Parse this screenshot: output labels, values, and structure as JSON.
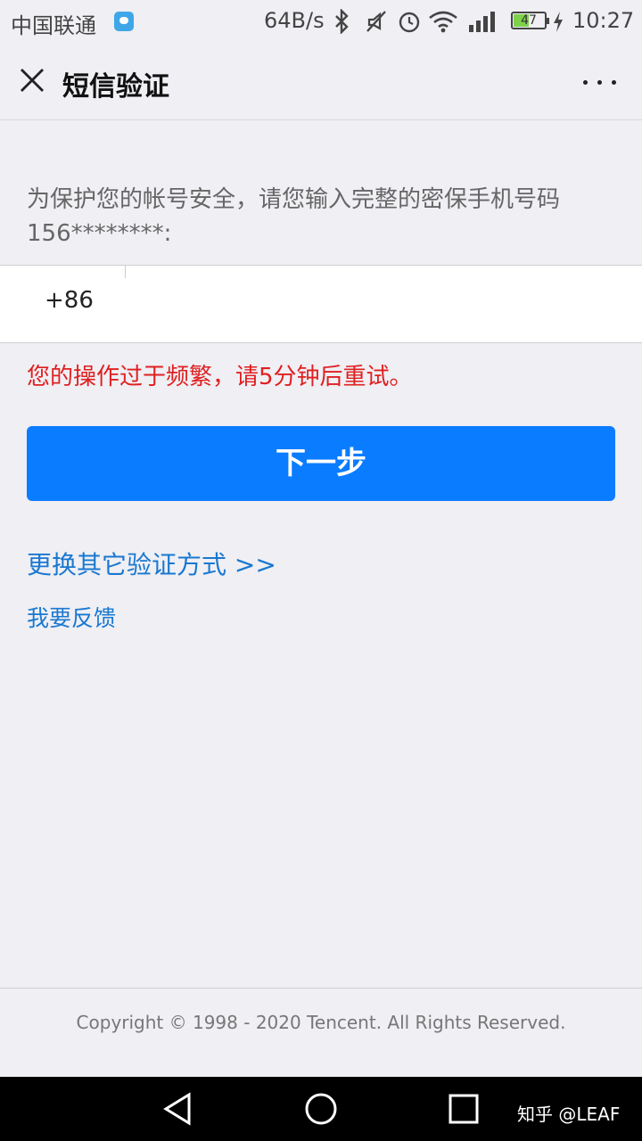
{
  "status_bar": {
    "carrier": "中国联通",
    "net_speed": "64B/s",
    "battery_level": "47",
    "time": "10:27",
    "icons": [
      "message-icon",
      "bluetooth-icon",
      "mute-icon",
      "alarm-icon",
      "wifi-icon",
      "signal-icon",
      "battery-icon",
      "charging-icon"
    ]
  },
  "header": {
    "title": "短信验证",
    "close_icon": "close-icon",
    "more_icon": "more-icon"
  },
  "main": {
    "hint": "为保护您的帐号安全，请您输入完整的密保手机号码156********:",
    "country_code": "+86",
    "phone_value": "",
    "error": "您的操作过于频繁，请5分钟后重试。",
    "next_button": "下一步",
    "switch_link": "更换其它验证方式 >>",
    "feedback_link": "我要反馈"
  },
  "footer": {
    "copyright": "Copyright © 1998 - 2020 Tencent. All Rights Reserved."
  },
  "nav_bar": {
    "watermark": "知乎 @LEAF"
  },
  "colors": {
    "background": "#efeff4",
    "primary_button": "#0a7cff",
    "error": "#e02020",
    "link": "#1a78d0"
  }
}
